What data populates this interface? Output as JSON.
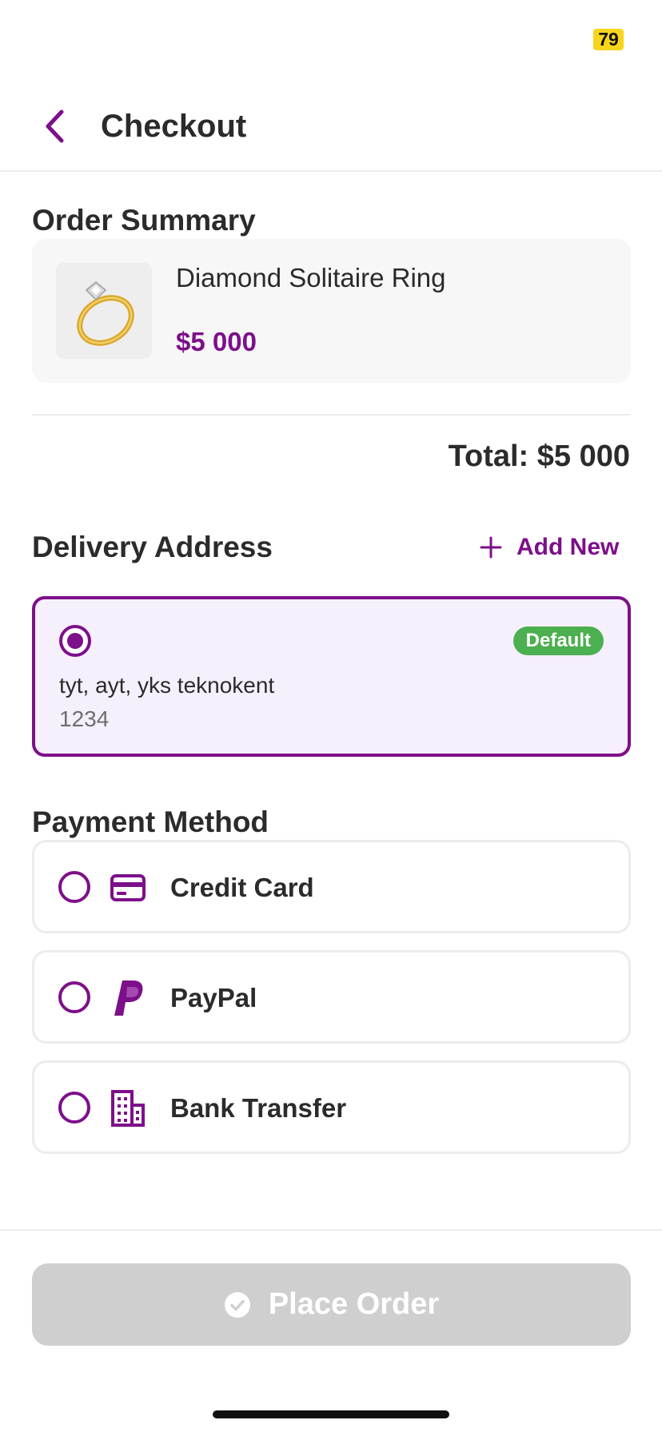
{
  "status": {
    "badge": "79"
  },
  "header": {
    "title": "Checkout"
  },
  "order_summary": {
    "title": "Order Summary",
    "item": {
      "name": "Diamond Solitaire Ring",
      "price": "$5 000"
    },
    "total": "Total: $5 000"
  },
  "delivery": {
    "title": "Delivery Address",
    "add_new": "Add New",
    "address": {
      "line": "tyt, ayt, yks teknokent",
      "zip": "1234",
      "badge": "Default",
      "selected": true
    }
  },
  "payment": {
    "title": "Payment Method",
    "options": [
      {
        "label": "Credit Card",
        "icon": "credit-card-icon",
        "selected": false
      },
      {
        "label": "PayPal",
        "icon": "paypal-icon",
        "selected": false
      },
      {
        "label": "Bank Transfer",
        "icon": "bank-icon",
        "selected": false
      }
    ]
  },
  "footer": {
    "place_order": "Place Order",
    "enabled": false
  },
  "colors": {
    "accent": "#7d0f8a",
    "success": "#4caf50",
    "disabled": "#cfcfcf"
  }
}
